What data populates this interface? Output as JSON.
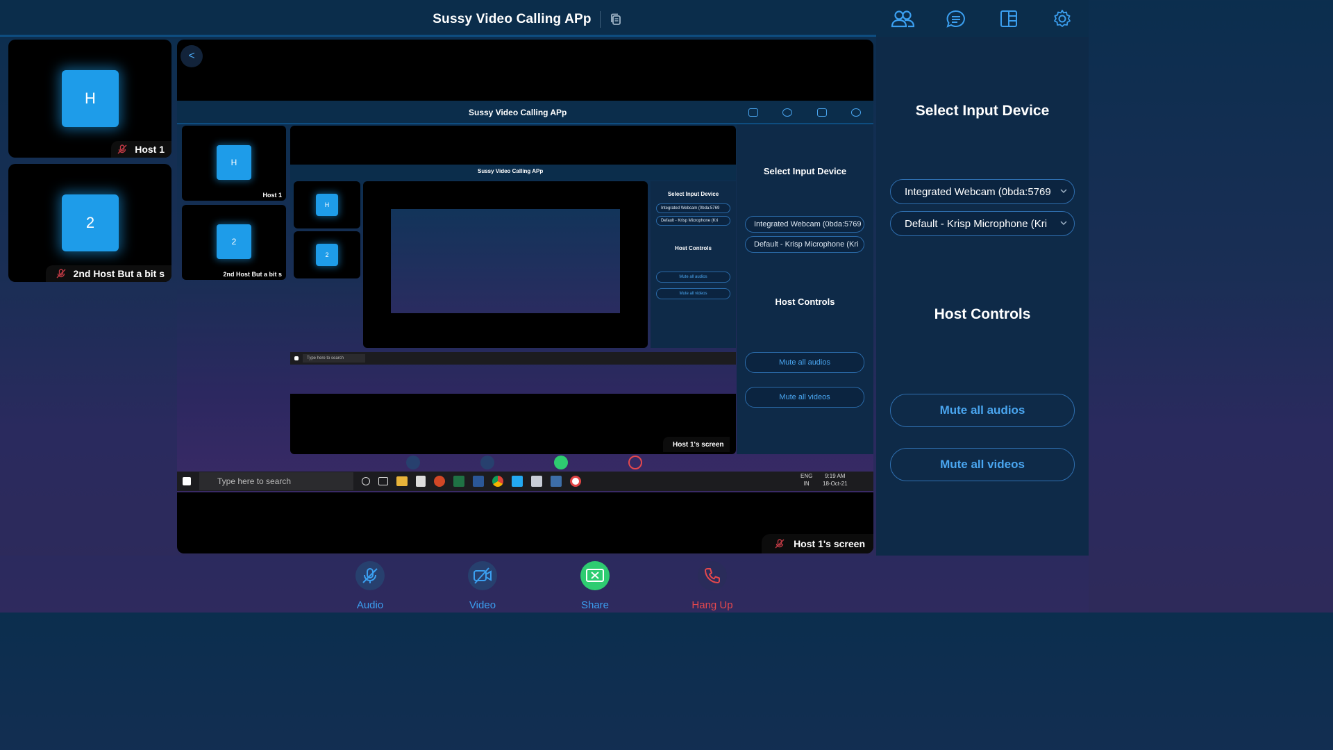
{
  "app": {
    "title": "Sussy Video Calling APp"
  },
  "top_icons": [
    "participants-icon",
    "chat-icon",
    "layout-icon",
    "settings-icon"
  ],
  "participants": [
    {
      "initial": "H",
      "name": "Host 1",
      "muted": true
    },
    {
      "initial": "2",
      "name": "2nd Host But a bit s",
      "muted": true
    }
  ],
  "stage": {
    "back_label": "<",
    "screen_label": "Host 1's screen"
  },
  "nested": {
    "title": "Sussy Video Calling APp",
    "select_heading": "Select Input Device",
    "camera": "Integrated Webcam (0bda:5769",
    "mic": "Default - Krisp Microphone (Kri",
    "host_controls": "Host Controls",
    "mute_audios": "Mute all audios",
    "mute_videos": "Mute all videos",
    "tile1": "Host 1",
    "tile2": "2nd Host But a bit s",
    "tile1_initial": "H",
    "tile2_initial": "2",
    "screen_label": "Host 1's screen",
    "search_placeholder": "Type here to search",
    "lang": "ENG",
    "region": "IN",
    "time": "9:19 AM",
    "date": "18-Oct-21"
  },
  "panel": {
    "select_heading": "Select Input Device",
    "camera_device": "Integrated Webcam (0bda:5769",
    "mic_device": "Default - Krisp Microphone (Kri",
    "host_controls_heading": "Host Controls",
    "mute_audios": "Mute all audios",
    "mute_videos": "Mute all videos"
  },
  "controls": {
    "audio": "Audio",
    "video": "Video",
    "share": "Share",
    "hangup": "Hang Up"
  },
  "colors": {
    "accent": "#1e9ce9",
    "link": "#4aa6f0",
    "share": "#2ecc71",
    "hangup": "#e5484d",
    "panel": "#0e2a48"
  }
}
